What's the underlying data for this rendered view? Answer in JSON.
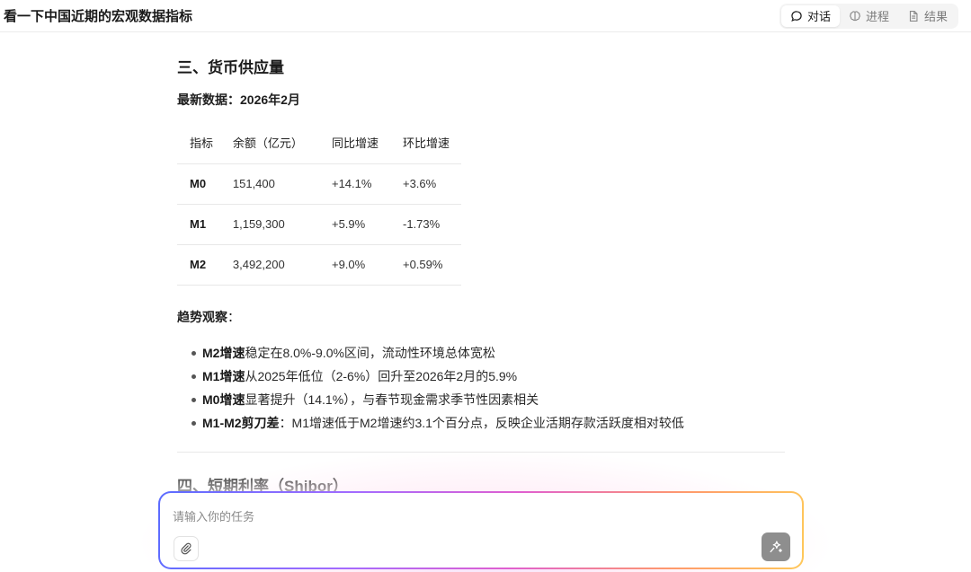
{
  "header": {
    "title": "看一下中国近期的宏观数据指标",
    "tabs": [
      {
        "label": "对话",
        "icon": "chat-bubble-icon",
        "active": true
      },
      {
        "label": "进程",
        "icon": "brain-icon",
        "active": false
      },
      {
        "label": "结果",
        "icon": "document-icon",
        "active": false
      }
    ]
  },
  "section3": {
    "title": "三、货币供应量",
    "latest": "最新数据：2026年2月",
    "table": {
      "headers": [
        "指标",
        "余额（亿元）",
        "同比增速",
        "环比增速"
      ],
      "rows": [
        [
          "M0",
          "151,400",
          "+14.1%",
          "+3.6%"
        ],
        [
          "M1",
          "1,159,300",
          "+5.9%",
          "-1.73%"
        ],
        [
          "M2",
          "3,492,200",
          "+9.0%",
          "+0.59%"
        ]
      ]
    },
    "trend_title": "趋势观察",
    "trend_colon": "：",
    "trends": [
      {
        "bold": "M2增速",
        "text": "稳定在8.0%-9.0%区间，流动性环境总体宽松"
      },
      {
        "bold": "M1增速",
        "text": "从2025年低位（2-6%）回升至2026年2月的5.9%"
      },
      {
        "bold": "M0增速",
        "text": "显著提升（14.1%），与春节现金需求季节性因素相关"
      },
      {
        "bold": "M1-M2剪刀差",
        "text": "：M1增速低于M2增速约3.1个百分点，反映企业活期存款活跃度相对较低"
      }
    ]
  },
  "section4": {
    "title": "四、短期利率（Shibor）"
  },
  "composer": {
    "placeholder": "请输入你的任务",
    "attach_icon": "paperclip-icon",
    "send_icon": "sparkle-send-icon"
  }
}
